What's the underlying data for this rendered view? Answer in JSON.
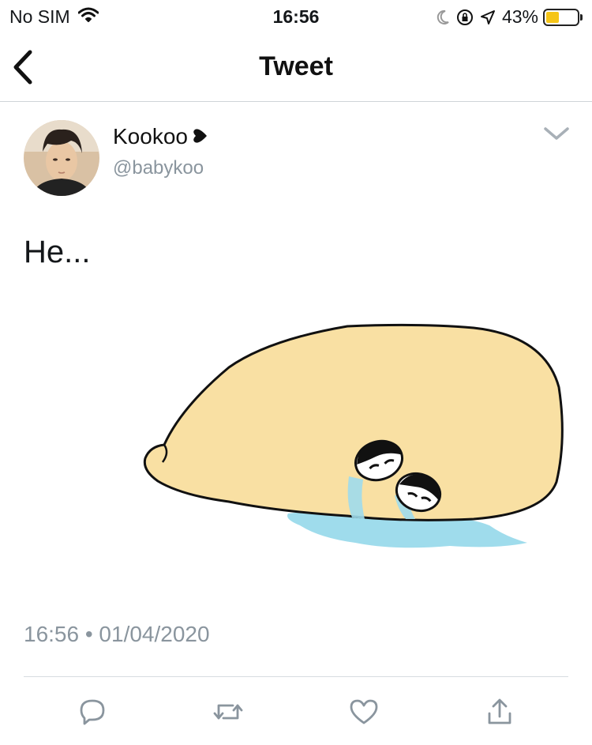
{
  "status_bar": {
    "carrier": "No SIM",
    "time": "16:56",
    "battery_percent": "43%",
    "battery_level": 0.43,
    "icons": [
      "wifi-icon",
      "moon-icon",
      "rotation-lock-icon",
      "location-icon",
      "battery-icon"
    ]
  },
  "nav": {
    "title": "Tweet",
    "back_icon": "chevron-left-icon"
  },
  "tweet": {
    "display_name": "Kookoo",
    "name_emoji": "heart-icon",
    "handle": "@babykoo",
    "text": "He...",
    "timestamp": "16:56 • 01/04/2020",
    "media_description_icon": "image",
    "colors": {
      "blob": "#f9e0a3",
      "water": "#9fdcec",
      "secondary_text": "#8a959e"
    }
  },
  "actions": [
    {
      "name": "reply",
      "icon": "reply-icon"
    },
    {
      "name": "retweet",
      "icon": "retweet-icon"
    },
    {
      "name": "like",
      "icon": "heart-outline-icon"
    },
    {
      "name": "share",
      "icon": "share-icon"
    }
  ]
}
